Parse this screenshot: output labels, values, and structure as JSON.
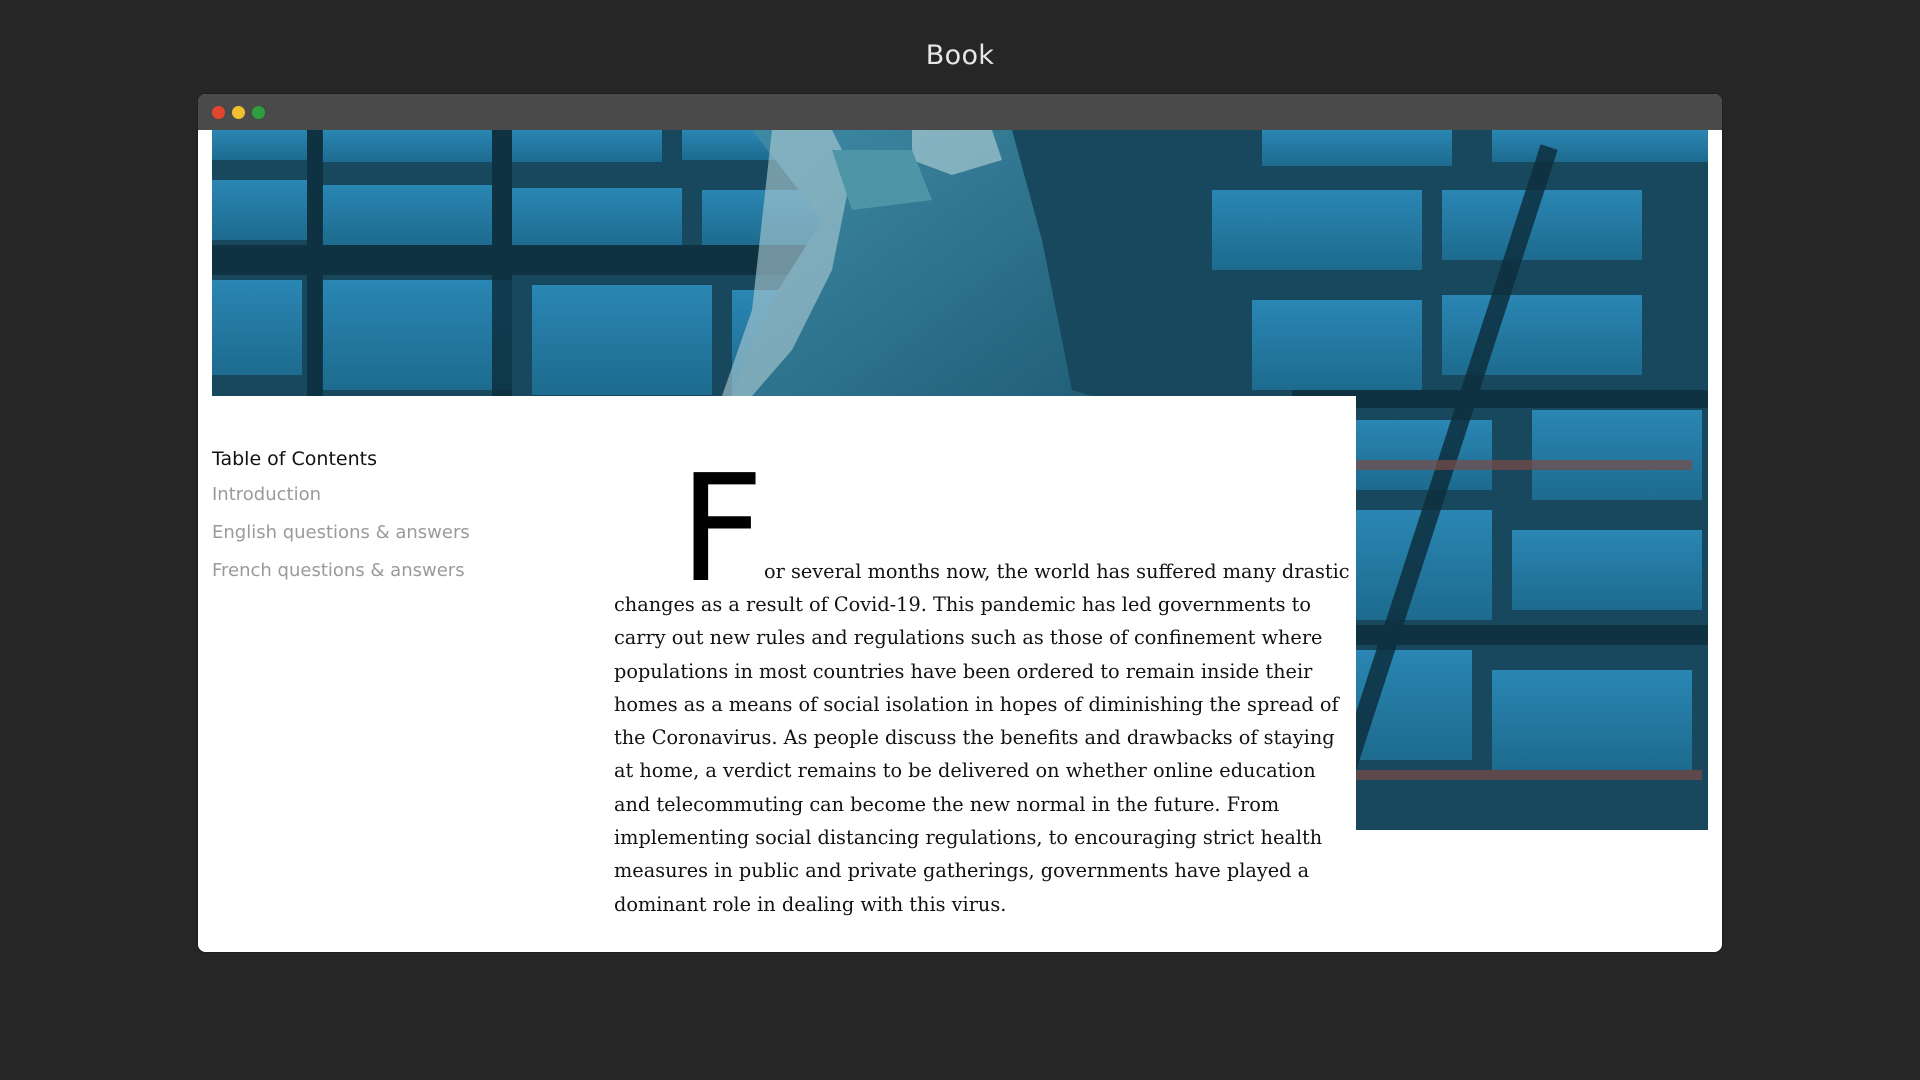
{
  "page": {
    "title": "Book"
  },
  "window": {
    "controls": [
      "close",
      "minimize",
      "maximize"
    ],
    "colors": {
      "close": "#e2462f",
      "minimize": "#efc02e",
      "maximize": "#2e9e3e",
      "titlebar": "#4a4a4a",
      "background": "#262626"
    }
  },
  "hero": {
    "icon": "hero-image",
    "accent": "#1f6f8f"
  },
  "toc": {
    "heading": "Table of Contents",
    "items": [
      "Introduction",
      "English questions & answers",
      "French questions & answers"
    ]
  },
  "article": {
    "dropcap": "F",
    "first_run": "or several months now, the world has suffered many drastic",
    "body": "changes as a result of Covid-19. This pandemic has led governments to carry out new rules and regulations such as those of confinement where populations in most countries have been ordered to remain inside their homes as a means of social isolation in hopes of diminishing the spread of the Coronavirus. As people discuss the benefits and drawbacks of staying at home, a verdict remains to be delivered on whether online education and telecommuting can become the new normal in the future. From implementing social distancing regulations, to encouraging strict health measures in public and private gatherings, governments have played a dominant role in dealing with this virus."
  }
}
